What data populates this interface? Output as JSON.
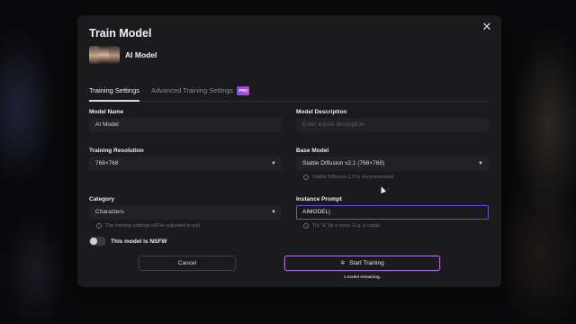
{
  "dialog": {
    "title": "Train Model",
    "close_icon": "close-icon"
  },
  "model": {
    "name": "AI Model"
  },
  "tabs": [
    {
      "label": "Training Settings",
      "active": true
    },
    {
      "label": "Advanced Training Settings",
      "active": false,
      "badge": "PRO"
    }
  ],
  "form": {
    "model_name": {
      "label": "Model Name",
      "value": "AI Model"
    },
    "model_description": {
      "label": "Model Description",
      "placeholder": "Enter a brief description"
    },
    "training_resolution": {
      "label": "Training Resolution",
      "value": "768×768"
    },
    "base_model": {
      "label": "Base Model",
      "value": "Stable Diffusion v2.1 (768×768)",
      "hint": "Stable Diffusion 1.5 is recommended."
    },
    "category": {
      "label": "Category",
      "value": "Characters",
      "hint": "The training settings will be adjusted to suit"
    },
    "instance_prompt": {
      "label": "Instance Prompt",
      "value": "AIMODEL|",
      "hint": "Try \"a\" by a noun. E.g. a castle"
    }
  },
  "nsfw": {
    "label": "This model is NSFW",
    "on": false
  },
  "buttons": {
    "cancel": "Cancel",
    "start": "Start Training"
  },
  "remaining_text": "1 model remaining.",
  "colors": {
    "accent": "#a46ad6",
    "focus_border": "#5c57c8",
    "modal_bg": "#1b1b1e"
  }
}
